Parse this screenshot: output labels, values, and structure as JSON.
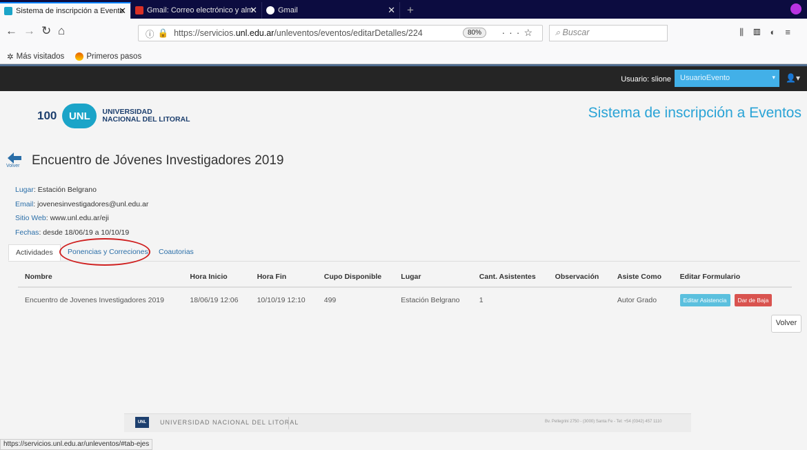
{
  "browser": {
    "tabs": [
      {
        "label": "Sistema de inscripción a Evento",
        "active": true
      },
      {
        "label": "Gmail: Correo electrónico y alm",
        "active": false
      },
      {
        "label": "Gmail",
        "active": false
      }
    ],
    "url_prefix": "https://servicios.",
    "url_domain": "unl.edu.ar",
    "url_path": "/unleventos/eventos/editarDetalles/224",
    "zoom": "80%",
    "search_placeholder": "Buscar",
    "bookmarks": [
      "Más visitados",
      "Primeros pasos"
    ],
    "status_url": "https://servicios.unl.edu.ar/unleventos/#tab-ejes"
  },
  "topnav": {
    "user_label": "Usuario: slione",
    "user_select": "UsuarioEvento"
  },
  "header": {
    "logo_100": "100",
    "logo_unl": "UNL",
    "logo_line1": "UNIVERSIDAD",
    "logo_line2": "NACIONAL DEL LITORAL",
    "system_title": "Sistema de inscripción a Eventos"
  },
  "event": {
    "back_label": "Volver",
    "title": "Encuentro de Jóvenes Investigadores 2019",
    "info": [
      {
        "label": "Lugar",
        "value": "Estación Belgrano"
      },
      {
        "label": "Email",
        "value": "jovenesinvestigadores@unl.edu.ar"
      },
      {
        "label": "Sitio Web",
        "value": "www.unl.edu.ar/eji"
      },
      {
        "label": "Fechas",
        "value": "desde 18/06/19 a 10/10/19"
      }
    ]
  },
  "tabs": [
    "Actividades",
    "Ponencias y Correciones",
    "Coautorias"
  ],
  "table": {
    "headers": [
      "Nombre",
      "Hora Inicio",
      "Hora Fin",
      "Cupo Disponible",
      "Lugar",
      "Cant. Asistentes",
      "Observación",
      "Asiste Como",
      "Editar Formulario"
    ],
    "rows": [
      [
        "Encuentro de Jovenes Investigadores 2019",
        "18/06/19 12:06",
        "10/10/19 12:10",
        "499",
        "Estación Belgrano",
        "1",
        "",
        "Autor Grado"
      ]
    ],
    "btn_edit": "Editar Asistencia",
    "btn_drop": "Dar de Baja"
  },
  "volver_button": "Volver",
  "footer": {
    "logo": "UNL",
    "text": "UNIVERSIDAD NACIONAL DEL LITORAL",
    "address": "Bv. Pellegrini 2750 - (3000) Santa Fe - Tel: +54 (0342) 457 1110"
  },
  "colors": {
    "accent": "#42b0e8",
    "title": "#29a3d6",
    "highlight_circle": "#cf1f1f",
    "danger": "#d9534f"
  }
}
